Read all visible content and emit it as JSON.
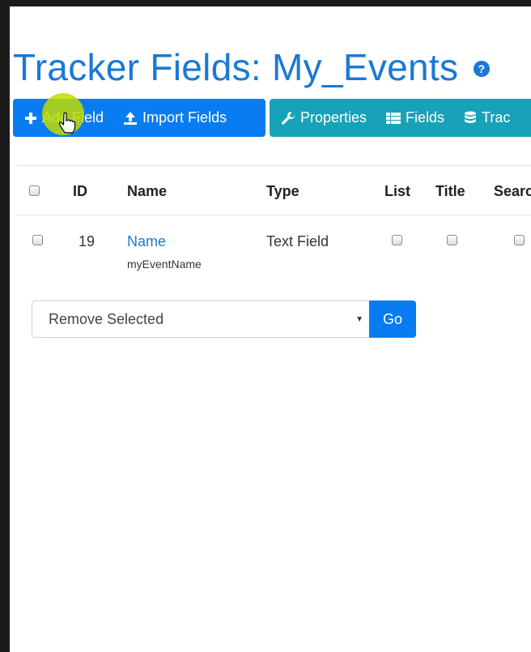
{
  "page": {
    "title": "Tracker Fields: My_Events",
    "help_icon_glyph": "?"
  },
  "toolbar": {
    "primary": [
      {
        "label": "Add Field",
        "icon": "plus-icon"
      },
      {
        "label": "Import Fields",
        "icon": "upload-icon"
      }
    ],
    "secondary": [
      {
        "label": "Properties",
        "icon": "wrench-icon"
      },
      {
        "label": "Fields",
        "icon": "list-icon"
      },
      {
        "label": "Trac",
        "icon": "database-icon"
      }
    ]
  },
  "table": {
    "columns": [
      "ID",
      "Name",
      "Type",
      "List",
      "Title",
      "Searc"
    ],
    "rows": [
      {
        "id": "19",
        "name": "Name",
        "perm_name": "myEventName",
        "type": "Text Field"
      }
    ]
  },
  "bulk_action": {
    "selected": "Remove Selected",
    "go_label": "Go"
  },
  "colors": {
    "primary": "#0a7cf1",
    "info": "#17a2b8",
    "title": "#1a78d6"
  }
}
